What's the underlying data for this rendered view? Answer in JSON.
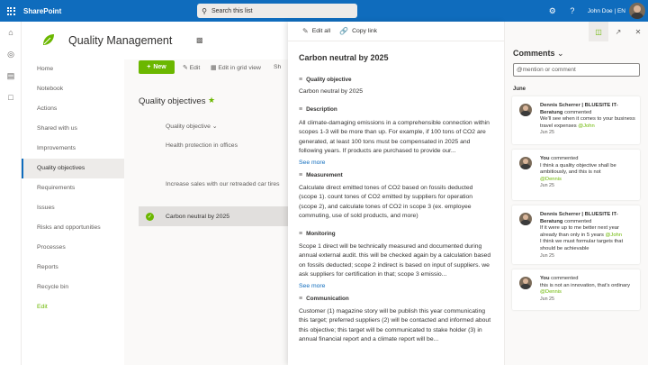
{
  "topbar": {
    "brand": "SharePoint",
    "search_placeholder": "Search this list",
    "user_name": "John Doe | EN",
    "icons": [
      "waffle-icon",
      "gear-icon",
      "help-icon",
      "avatar"
    ]
  },
  "site": {
    "title": "Quality Management",
    "accent_color": "#6bb700",
    "brand_color": "#0f6cbd"
  },
  "nav": {
    "items": [
      "Home",
      "Notebook",
      "Actions",
      "Shared with us",
      "Improvements",
      "Quality objectives",
      "Requirements",
      "Issues",
      "Risks and opportunities",
      "Processes",
      "Reports",
      "Recycle bin",
      "Edit"
    ],
    "active_index": 5
  },
  "commandbar": {
    "new_label": "New",
    "edit_label": "Edit",
    "grid_label": "Edit in grid view",
    "share_label": "Sh"
  },
  "list": {
    "title": "Quality objectives",
    "column_header": "Quality objective",
    "rows": [
      "Health protection in offices",
      "Increase sales with our retreaded car tires",
      "Carbon neutral by 2025"
    ]
  },
  "panel": {
    "edit_all": "Edit all",
    "copy_link": "Copy link",
    "title": "Carbon neutral by 2025",
    "fields": [
      {
        "label": "Quality objective",
        "value": "Carbon neutral by 2025",
        "see_more": ""
      },
      {
        "label": "Description",
        "value": "All climate-damaging emissions in a comprehensible connection within scopes 1-3 will be more than up. For example, if 100 tons of CO2 are generated, at least 100 tons must be compensated in 2025 and following years. If products are purchased to provide our...",
        "see_more": "See more"
      },
      {
        "label": "Measurement",
        "value": "Calculate direct emitted tones of CO2 based on fossils deducted (scope 1). count tones of CO2 emitted by suppliers for operation (scope 2), and calculate tones of CO2 in scope 3 (ex. employee commuting, use of sold products, and more)",
        "see_more": ""
      },
      {
        "label": "Monitoring",
        "value": "Scope 1 direct will be technically measured and documented during annual external audit. this will be checked again by a calculation based on fossils deducted; scope 2 indirect is based on input of suppliers. we ask suppliers for certification in that; scope 3 emissio...",
        "see_more": "See more"
      },
      {
        "label": "Communication",
        "value": "Customer (1) magazine story will be publish this year communicating this target; preferred suppliers (2) will be contacted and informed about this objective; this target will be communicated to stake holder (3) in annual financial report and a climate report will be...",
        "see_more": ""
      }
    ]
  },
  "comments": {
    "title": "Comments",
    "input_placeholder": "@mention or comment",
    "month": "June",
    "items": [
      {
        "author": "Dennis Scherrer | BLUESITE IT-Beratung",
        "verb": "commented",
        "text": "We'll see when it comes to your business travel expenses",
        "mention": "@John",
        "after": "",
        "date": "Jun 25"
      },
      {
        "author": "You",
        "verb": "commented",
        "text": "I think a quality objective shall be ambitiously, and this is not",
        "mention": "@Dennis",
        "after": "",
        "date": "Jun 25"
      },
      {
        "author": "Dennis Scherrer | BLUESITE IT-Beratung",
        "verb": "commented",
        "text": "If it were up to me better next year already than only in 5 years",
        "mention": "@John",
        "after": "I think we must formular targets that should be achievable",
        "date": "Jun 25"
      },
      {
        "author": "You",
        "verb": "commented",
        "text": "this is not an innovation, that's ordinary",
        "mention": "@Dennis",
        "after": "",
        "date": "Jun 25"
      }
    ]
  }
}
